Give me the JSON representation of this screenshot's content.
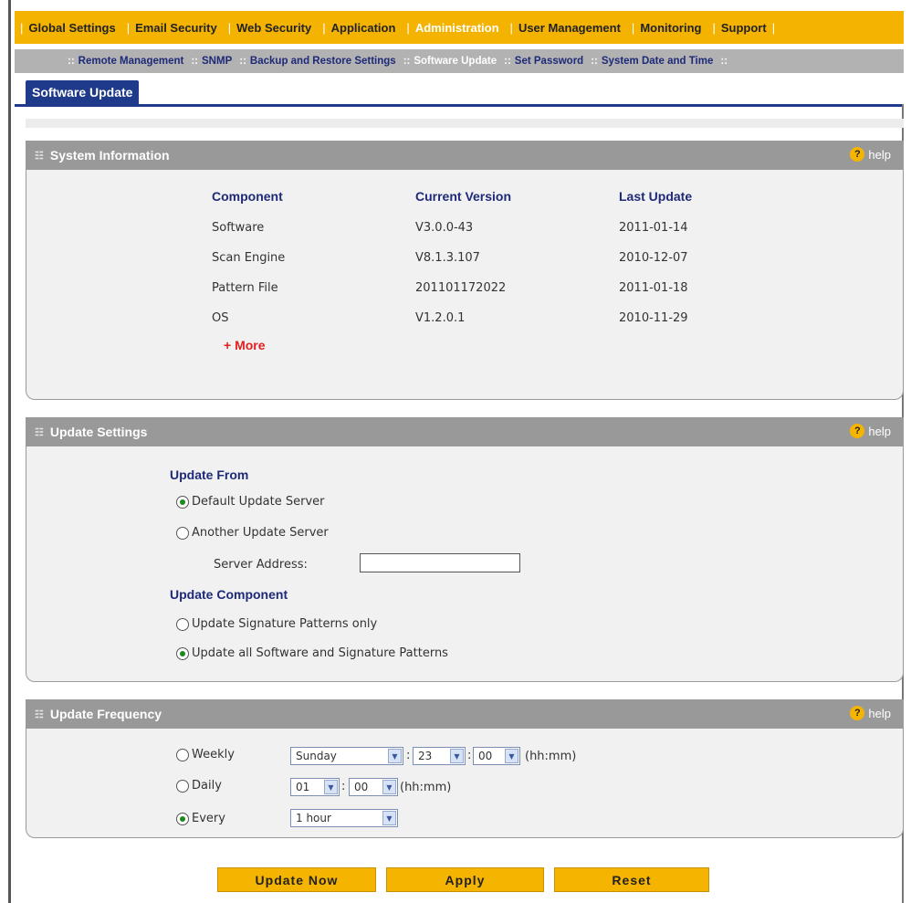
{
  "nav_top": [
    {
      "label": "Global Settings"
    },
    {
      "label": "Email Security"
    },
    {
      "label": "Web Security"
    },
    {
      "label": "Application"
    },
    {
      "label": "Administration",
      "active": true
    },
    {
      "label": "User Management"
    },
    {
      "label": "Monitoring"
    },
    {
      "label": "Support"
    }
  ],
  "nav_sub": [
    {
      "label": "Remote Management"
    },
    {
      "label": "SNMP"
    },
    {
      "label": "Backup and Restore Settings"
    },
    {
      "label": "Software Update",
      "active": true
    },
    {
      "label": "Set Password"
    },
    {
      "label": "System Date and Time"
    }
  ],
  "nav_separator": "|",
  "nav_sub_separator": "::",
  "tab": {
    "label": "Software Update"
  },
  "help_label": "help",
  "system_info": {
    "title": "System Information",
    "columns": [
      "Component",
      "Current Version",
      "Last Update"
    ],
    "rows": [
      [
        "Software",
        "V3.0.0-43",
        "2011-01-14"
      ],
      [
        "Scan Engine",
        "V8.1.3.107",
        "2010-12-07"
      ],
      [
        "Pattern File",
        "201101172022",
        "2011-01-18"
      ],
      [
        "OS",
        "V1.2.0.1",
        "2010-11-29"
      ]
    ],
    "more_label": "+ More"
  },
  "update_settings": {
    "title": "Update Settings",
    "update_from_label": "Update From",
    "default_server_label": "Default Update Server",
    "another_server_label": "Another Update Server",
    "selected_server": "default",
    "server_address_label": "Server Address:",
    "server_address_value": "",
    "update_component_label": "Update Component",
    "signature_only_label": "Update Signature Patterns only",
    "all_software_label": "Update all Software and Signature Patterns",
    "selected_component": "all"
  },
  "update_frequency": {
    "title": "Update Frequency",
    "weekly_label": "Weekly",
    "daily_label": "Daily",
    "every_label": "Every",
    "selected": "every",
    "weekly_day": "Sunday",
    "weekly_hour": "23",
    "weekly_minute": "00",
    "daily_hour": "01",
    "daily_minute": "00",
    "every_value": "1 hour",
    "time_format_label": "(hh:mm)",
    "time_separator": ":"
  },
  "buttons": {
    "update_now": "Update Now",
    "apply": "Apply",
    "reset": "Reset"
  },
  "colors": {
    "accent": "#f3b300",
    "tab_blue": "#1f3a8a",
    "header_gray": "#999999",
    "more_red": "#e02020"
  }
}
